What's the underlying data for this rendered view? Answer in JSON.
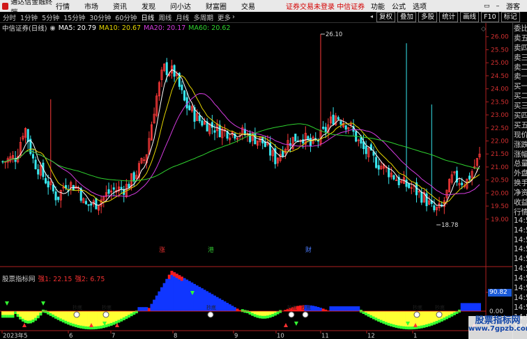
{
  "app": {
    "name": "通达信金融终端",
    "menu": [
      "行情",
      "市场",
      "资讯",
      "发现",
      "问小达",
      "财富圈",
      "交易"
    ],
    "login_status": "证券交易未登录",
    "broker": "中信证券",
    "right_menu": [
      "功能",
      "公式",
      "选项"
    ],
    "window_buttons": [
      "▭",
      "—",
      "□",
      "×"
    ],
    "guest": "游客"
  },
  "period_bar": {
    "periods": [
      "分时",
      "1分钟",
      "5分钟",
      "15分钟",
      "30分钟",
      "60分钟",
      "日线",
      "周线",
      "月线",
      "多周期",
      "更多"
    ],
    "active": "日线",
    "more_arrow": "›",
    "tools": [
      "复权",
      "叠加",
      "多股",
      "统计",
      "画线",
      "F10",
      "标记"
    ],
    "tool_arrow": "◂"
  },
  "main_chart": {
    "stock": "中信证券(日线)",
    "ma5": "MA5: 20.79",
    "ma10": "MA10: 20.67",
    "ma20": "MA20: 20.17",
    "ma60": "MA60: 20.62",
    "high_label": "26.10",
    "low_label": "18.78",
    "price_ticks": [
      "26.00",
      "25.50",
      "25.00",
      "24.50",
      "24.00",
      "23.50",
      "23.00",
      "22.50",
      "22.00",
      "21.50",
      "21.00",
      "20.50",
      "20.00",
      "19.50",
      "19.00"
    ],
    "markers": [
      {
        "text": "涨",
        "color": "#e83030"
      },
      {
        "text": "港",
        "color": "#30c030"
      },
      {
        "text": "财",
        "color": "#4c7cff"
      }
    ],
    "colors": {
      "up": "#ff3a3a",
      "down": "#38e8f0",
      "ma5": "#ffffff",
      "ma10": "#e6d600",
      "ma20": "#d53ce0",
      "ma60": "#2fd32f"
    }
  },
  "indicator": {
    "name": "股票指标网",
    "v1": "强1: 22.15",
    "v2": "强2: 6.75",
    "value_box": "90.82",
    "left_tick": "0.00",
    "bubble_label": "抄底",
    "colors": {
      "red": "#ff1a1a",
      "blue": "#1036ff",
      "yellow": "#ffff33",
      "green": "#33ff33"
    }
  },
  "date_axis": [
    "2023年5",
    "6",
    "7",
    "8",
    "9",
    "10",
    "11",
    "12",
    "1"
  ],
  "right_panel": [
    "委比",
    "卖五",
    "卖四",
    "卖三",
    "卖二",
    "卖一",
    "买一",
    "买二",
    "买三",
    "买四",
    "买五",
    "现价",
    "涨跌",
    "涨幅",
    "总量",
    "外盘",
    "换手",
    "净资",
    "收益",
    "行情",
    "14:50",
    "14:50",
    "14:50",
    "14:50",
    "14:50",
    "14:50",
    "14:50",
    "14:50",
    "14:50",
    "14:50",
    "14:50",
    "14:50"
  ],
  "watermark": {
    "line1": "股票指标网",
    "line2": "www.7gpzb.com"
  }
}
